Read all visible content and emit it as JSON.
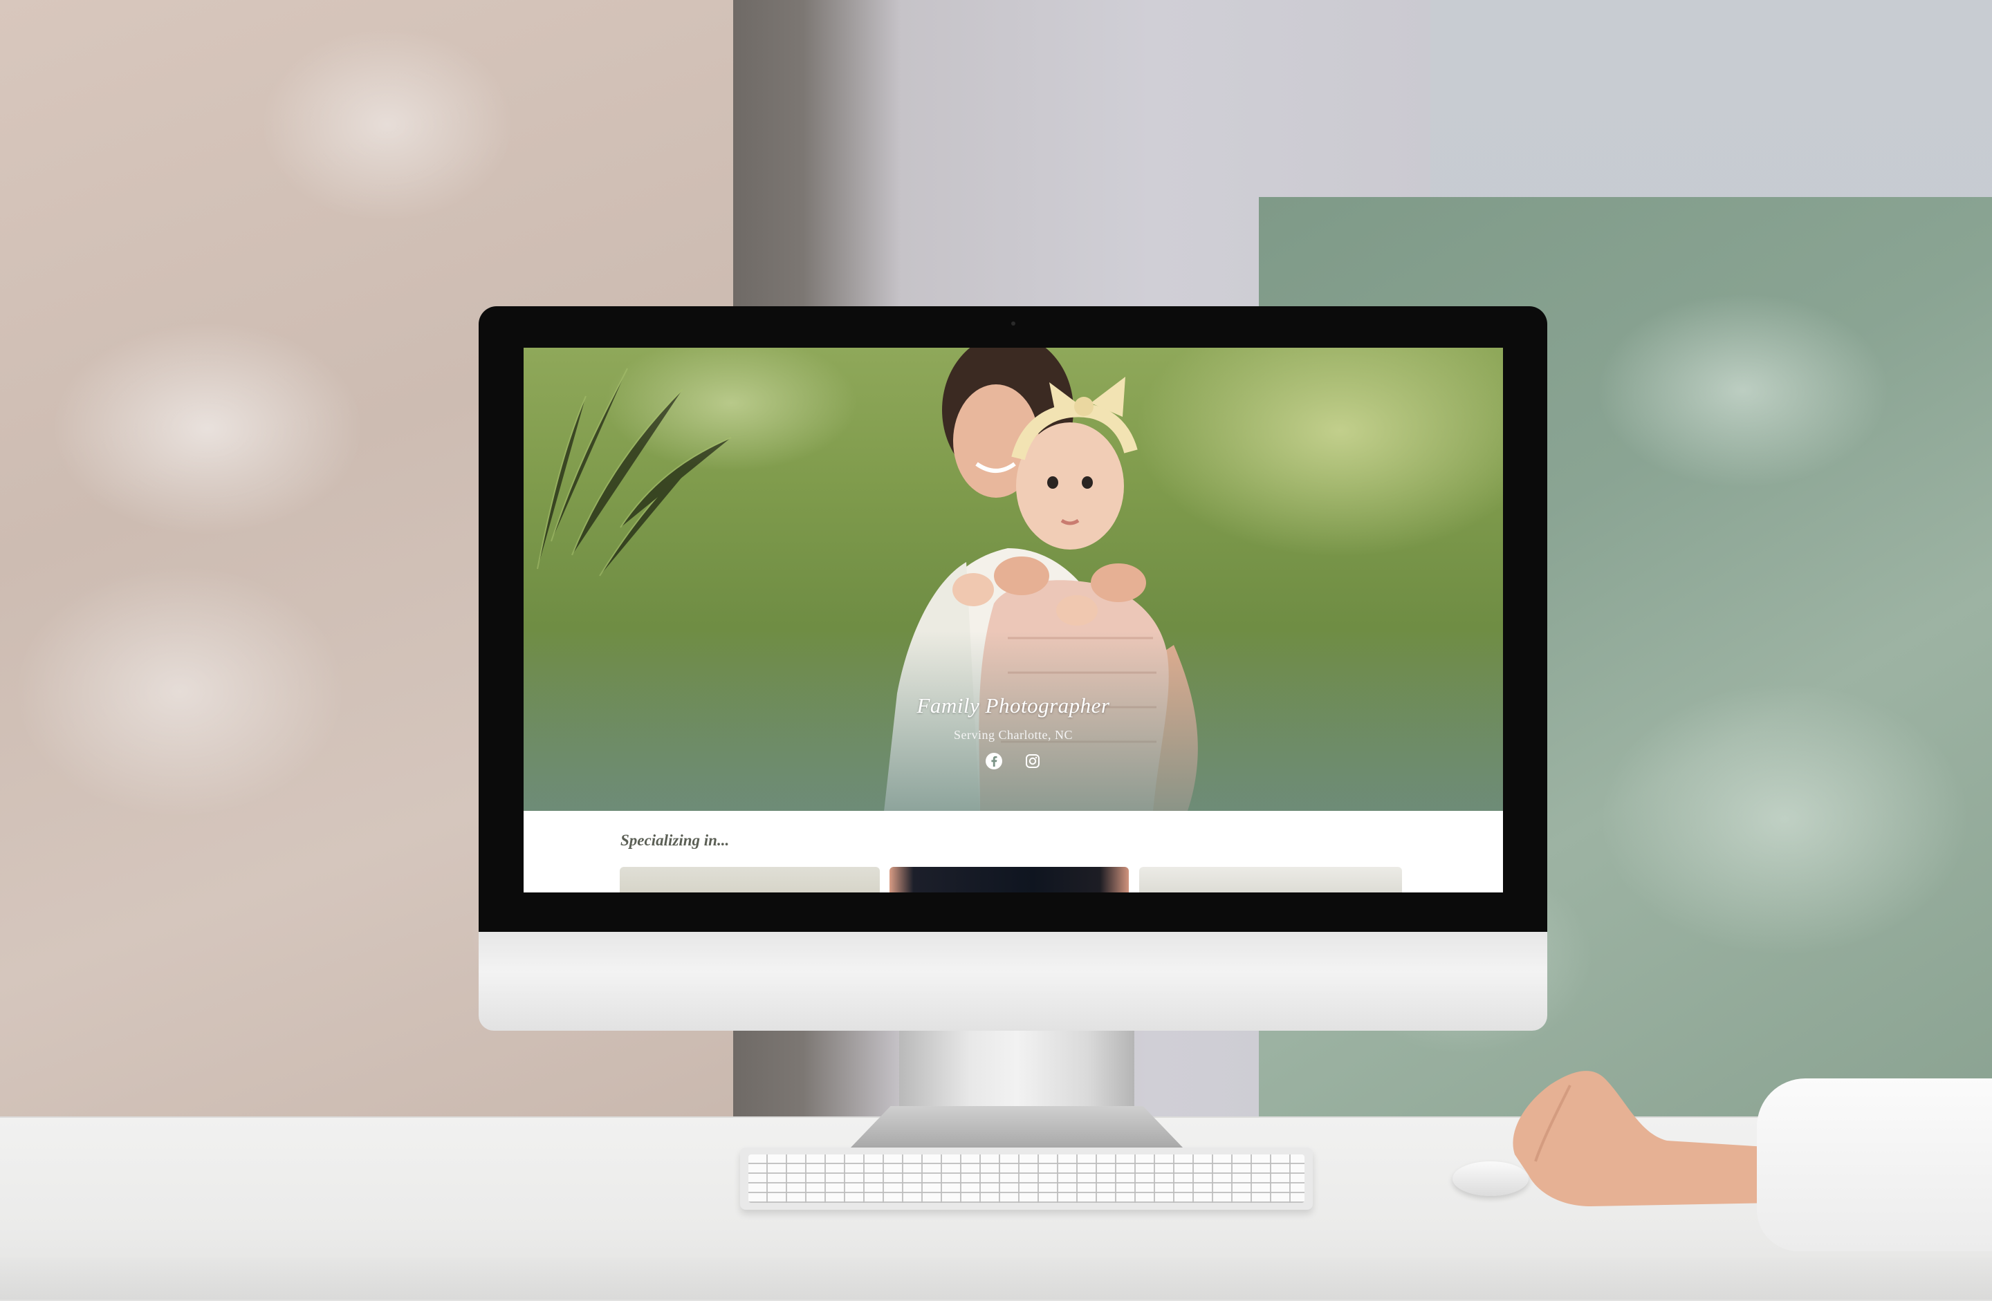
{
  "website": {
    "hero": {
      "title": "Family Photographer",
      "subtitle": "Serving Charlotte, NC",
      "social_icons": [
        "facebook-icon",
        "instagram-icon"
      ]
    },
    "section": {
      "heading": "Specializing in..."
    }
  },
  "colors": {
    "hero_text": "#ffffff",
    "section_heading": "#5b5f55",
    "page_background": "#ffffff"
  }
}
